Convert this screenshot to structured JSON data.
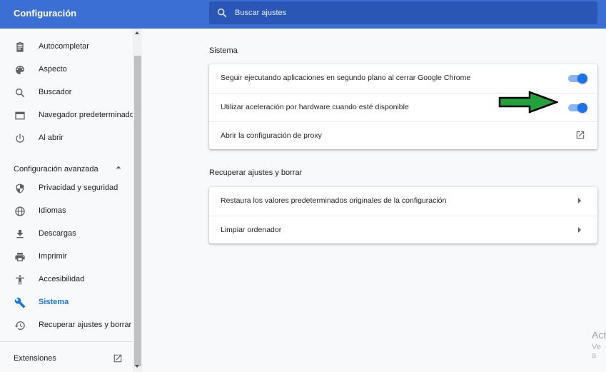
{
  "header": {
    "title": "Configuración",
    "search_placeholder": "Buscar ajustes"
  },
  "sidebar": {
    "items": [
      {
        "label": "Autocompletar",
        "icon": "clipboard-icon"
      },
      {
        "label": "Aspecto",
        "icon": "palette-icon"
      },
      {
        "label": "Buscador",
        "icon": "search-icon"
      },
      {
        "label": "Navegador predeterminado",
        "icon": "browser-window-icon"
      },
      {
        "label": "Al abrir",
        "icon": "power-icon"
      }
    ],
    "advanced_label": "Configuración avanzada",
    "advanced_items": [
      {
        "label": "Privacidad y seguridad",
        "icon": "shield-icon"
      },
      {
        "label": "Idiomas",
        "icon": "globe-icon"
      },
      {
        "label": "Descargas",
        "icon": "download-icon"
      },
      {
        "label": "Imprimir",
        "icon": "printer-icon"
      },
      {
        "label": "Accesibilidad",
        "icon": "accessibility-icon"
      },
      {
        "label": "Sistema",
        "icon": "wrench-icon",
        "active": true
      },
      {
        "label": "Recuperar ajustes y borrar",
        "icon": "history-icon"
      }
    ],
    "extensions_label": "Extensiones"
  },
  "main": {
    "system": {
      "title": "Sistema",
      "rows": [
        {
          "label": "Seguir ejecutando aplicaciones en segundo plano al cerrar Google Chrome",
          "toggle": true
        },
        {
          "label": "Utilizar aceleración por hardware cuando esté disponible",
          "toggle": true
        },
        {
          "label": "Abrir la configuración de proxy"
        }
      ]
    },
    "reset": {
      "title": "Recuperar ajustes y borrar",
      "rows": [
        {
          "label": "Restaura los valores predeterminados originales de la configuración"
        },
        {
          "label": "Limpiar ordenador"
        }
      ]
    }
  },
  "watermark": {
    "line1": "Act",
    "line2": "Ve a"
  },
  "colors": {
    "header": "#3b6fd4",
    "accent": "#1a73e8",
    "annotation_arrow": "#21a03c"
  }
}
